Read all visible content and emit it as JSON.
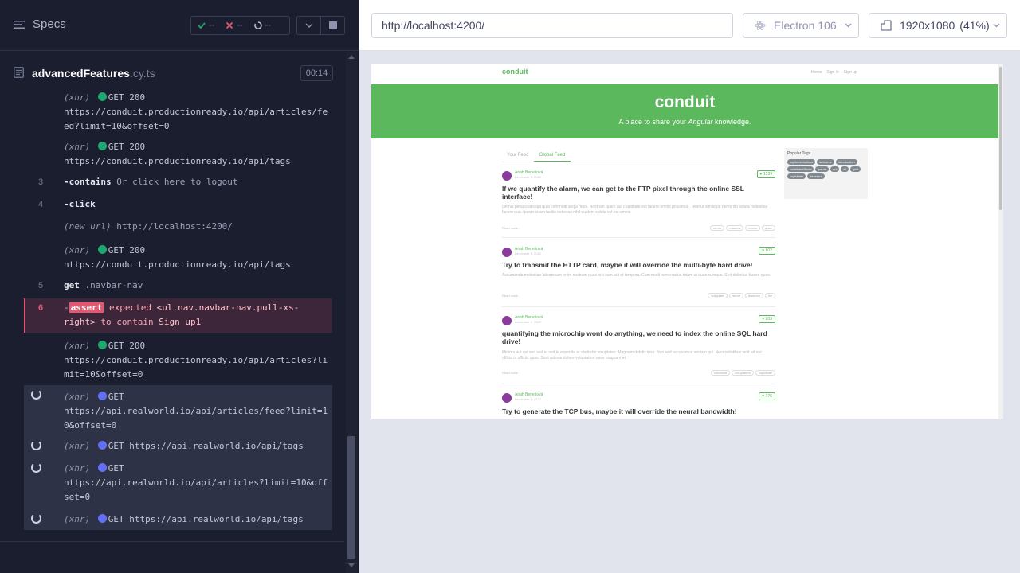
{
  "reporter": {
    "specs_label": "Specs",
    "stats": {
      "passed": "--",
      "failed": "--",
      "pending": "--"
    },
    "spec_file": {
      "name": "advancedFeatures",
      "ext": ".cy.ts"
    },
    "duration": "00:14",
    "commands": [
      {
        "type": "xhr",
        "kind": "GET",
        "status": "200",
        "color": "green",
        "prefix": "(xhr)",
        "url": "https://conduit.productionready.io/api/articles/feed?limit=10&offset=0"
      },
      {
        "type": "xhr",
        "kind": "GET",
        "status": "200",
        "color": "green",
        "prefix": "(xhr)",
        "url": "https://conduit.productionready.io/api/tags"
      },
      {
        "type": "cmd",
        "num": "3",
        "name": "-contains",
        "arg": "Or click here to logout"
      },
      {
        "type": "cmd",
        "num": "4",
        "name": "-click",
        "arg": ""
      },
      {
        "type": "event",
        "prefix": "(new url)",
        "arg": "http://localhost:4200/"
      },
      {
        "type": "xhr",
        "kind": "GET",
        "status": "200",
        "color": "green",
        "prefix": "(xhr)",
        "url": "https://conduit.productionready.io/api/tags"
      },
      {
        "type": "cmd",
        "num": "5",
        "name": "get",
        "arg": ".navbar-nav"
      },
      {
        "type": "assert",
        "num": "6",
        "dash": "-",
        "badge": "assert",
        "text1": "expected",
        "text2": "<ul.nav.navbar-nav.pull-xs-right>",
        "text3": "to contain",
        "text4": "Sign up1"
      },
      {
        "type": "xhr",
        "kind": "GET",
        "status": "200",
        "color": "green",
        "prefix": "(xhr)",
        "url": "https://conduit.productionready.io/api/articles?limit=10&offset=0"
      },
      {
        "type": "xhr-pending",
        "kind": "GET",
        "prefix": "(xhr)",
        "url": "https://api.realworld.io/api/articles/feed?limit=10&offset=0"
      },
      {
        "type": "xhr-pending",
        "kind": "GET",
        "prefix": "(xhr)",
        "url": "https://api.realworld.io/api/tags"
      },
      {
        "type": "xhr-pending",
        "kind": "GET",
        "prefix": "(xhr)",
        "url": "https://api.realworld.io/api/articles?limit=10&offset=0"
      },
      {
        "type": "xhr-pending",
        "kind": "GET",
        "prefix": "(xhr)",
        "url": "https://api.realworld.io/api/tags"
      }
    ]
  },
  "aut": {
    "url": "http://localhost:4200/",
    "browser": "Electron 106",
    "viewport": "1920x1080",
    "scale": "(41%)"
  },
  "app": {
    "brand": "conduit",
    "nav_links": [
      "Home",
      "Sign in",
      "Sign up"
    ],
    "banner_title": "conduit",
    "banner_sub_pre": "A place to share your ",
    "banner_sub_em": "Angular",
    "banner_sub_post": " knowledge.",
    "tab_your": "Your Feed",
    "tab_global": "Global Feed",
    "popular_tags_title": "Popular Tags",
    "popular_tags": [
      "implementations",
      "welcome",
      "introduction",
      "codebaseShow",
      "ipsum",
      "qui",
      "et",
      "quia",
      "cupiditate",
      "deserunt"
    ],
    "articles": [
      {
        "author": "Anah Benešová",
        "date": "December 9, 2022",
        "likes": "1339",
        "title": "If we quantify the alarm, we can get to the FTP pixel through the online SSL interface!",
        "desc": "Omnis perspiciatis qui quia commodi sequi modi. Nostrum quam aut cupiditate est facere omnis possimus. Tenetur similique nemo illo soluta molestias facere quo. Ipsam totam facilis delectus nihil quidem soluta vel est omnis.",
        "read_more": "Read more...",
        "tags": [
          "rerum",
          "maiores",
          "omnis",
          "quae"
        ]
      },
      {
        "author": "Anah Benešová",
        "date": "December 9, 2022",
        "likes": "602",
        "title": "Try to transmit the HTTP card, maybe it will override the multi-byte hard drive!",
        "desc": "Assumenda molestiae laboriosam enim nostrum quas nisi cum aut et tempora. Cum modi nemo natus totam ut quae cumque. Sed delectus facere quos.",
        "read_more": "Read more...",
        "tags": [
          "voluptate",
          "rerum",
          "ducimus",
          "hic"
        ]
      },
      {
        "author": "Anah Benešová",
        "date": "December 9, 2022",
        "likes": "203",
        "title": "quantifying the microchip wont do anything, we need to index the online SQL hard drive!",
        "desc": "Minima aut qui sed sed et sed in expedita et distinctio voluptates. Magnam debitis ipsa. Non sed accusamus veniam qui. Necessitatibus velit ad aut officia in officiis quos. Sunt ratione dolore voluptatem esse magnam et.",
        "read_more": "Read more...",
        "tags": [
          "commodi",
          "voluptatem",
          "cupiditate"
        ]
      },
      {
        "author": "Anah Benešová",
        "date": "December 9, 2022",
        "likes": "176",
        "title": "Try to generate the TCP bus, maybe it will override the neural bandwidth!"
      }
    ]
  },
  "colors": {
    "reporter_bg": "#1b1e2e",
    "success": "#1fa971",
    "fail": "#e45770",
    "pending": "#6470f3",
    "brand": "#5cb85c"
  },
  "icons": [
    "menu-icon",
    "check-icon",
    "x-icon",
    "spinner-icon",
    "chevron-down-icon",
    "stop-icon",
    "file-icon",
    "browser-icon",
    "viewport-icon",
    "heart-icon"
  ]
}
